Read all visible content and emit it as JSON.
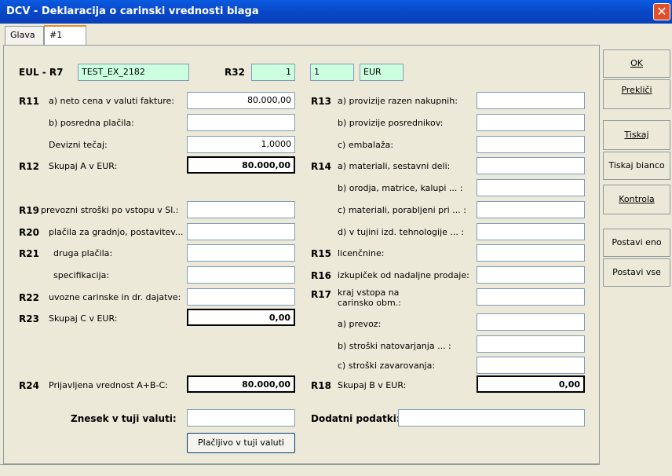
{
  "window": {
    "title": "DCV - Deklaracija o carinski vrednosti blaga",
    "close": "✕"
  },
  "tabs": [
    {
      "label": "Glava"
    },
    {
      "label": "#1"
    }
  ],
  "header": {
    "eul_label": "EUL - R7",
    "eul_value": "TEST_EX_2182",
    "r32_label": "R32",
    "r32_value": "1",
    "r32_value2": "1",
    "currency": "EUR"
  },
  "left": {
    "r11_code": "R11",
    "r11a_label": "a) neto cena v valuti fakture:",
    "r11a_value": "80.000,00",
    "r11b_label": "b) posredna plačila:",
    "r11b_value": "",
    "rate_label": "Devizni tečaj:",
    "rate_value": "1,0000",
    "r12_code": "R12",
    "r12_label": "Skupaj A v EUR:",
    "r12_value": "80.000,00",
    "r19_code": "R19",
    "r19_label": "prevozni stroški po vstopu v Sl.:",
    "r19_value": "",
    "r20_code": "R20",
    "r20_label": "plačila za gradnjo, postavitev...",
    "r20_value": "",
    "r21_code": "R21",
    "r21_label": "druga plačila:",
    "r21_value": "",
    "spec_label": "specifikacija:",
    "spec_value": "",
    "r22_code": "R22",
    "r22_label": "uvozne carinske in dr. dajatve:",
    "r22_value": "",
    "r23_code": "R23",
    "r23_label": "Skupaj C v EUR:",
    "r23_value": "0,00",
    "r24_code": "R24",
    "r24_label": "Prijavljena vrednost A+B-C:",
    "r24_value": "80.000,00",
    "foreign_label": "Znesek v tuji valuti:",
    "foreign_value": "",
    "pay_button": "Plačljivo v tuji valuti"
  },
  "right": {
    "r13_code": "R13",
    "r13a_label": "a) provizije razen nakupnih:",
    "r13a_value": "",
    "r13b_label": "b) provizije posrednikov:",
    "r13b_value": "",
    "r13c_label": "c) embalaža:",
    "r13c_value": "",
    "r14_code": "R14",
    "r14a_label": "a) materiali, sestavni deli:",
    "r14a_value": "",
    "r14b_label": "b) orodja, matrice, kalupi ... :",
    "r14b_value": "",
    "r14c_label": "c) materiali, porabljeni pri ... :",
    "r14c_value": "",
    "r14d_label": "d) v tujini izd. tehnologije ... :",
    "r14d_value": "",
    "r15_code": "R15",
    "r15_label": "licenčnine:",
    "r15_value": "",
    "r16_code": "R16",
    "r16_label": "izkupiček od nadaljne prodaje:",
    "r16_value": "",
    "r17_code": "R17",
    "r17_label1": "kraj vstopa na",
    "r17_label2": "carinsko obm.:",
    "r17a_label": "a) prevoz:",
    "r17a_value": "",
    "r17b_label": "b) stroški natovarjanja ... :",
    "r17b_value": "",
    "r17c_label": "c) stroški zavarovanja:",
    "r17c_value": "",
    "r18_code": "R18",
    "r18_label": "Skupaj B v EUR:",
    "r18_value": "0,00",
    "extra_label": "Dodatni podatki:",
    "extra_value": ""
  },
  "sidebar": {
    "ok": "OK",
    "cancel": "Prekliči",
    "print": "Tiskaj",
    "print_blank": "Tiskaj bianco",
    "check": "Kontrola",
    "set_one": "Postavi eno",
    "set_all": "Postavi vse"
  },
  "colors": {
    "title_bar": "#0a54d8",
    "highlight_field": "#ccffe0",
    "dialog_bg": "#ece9d8",
    "close_button": "#e0502a"
  }
}
